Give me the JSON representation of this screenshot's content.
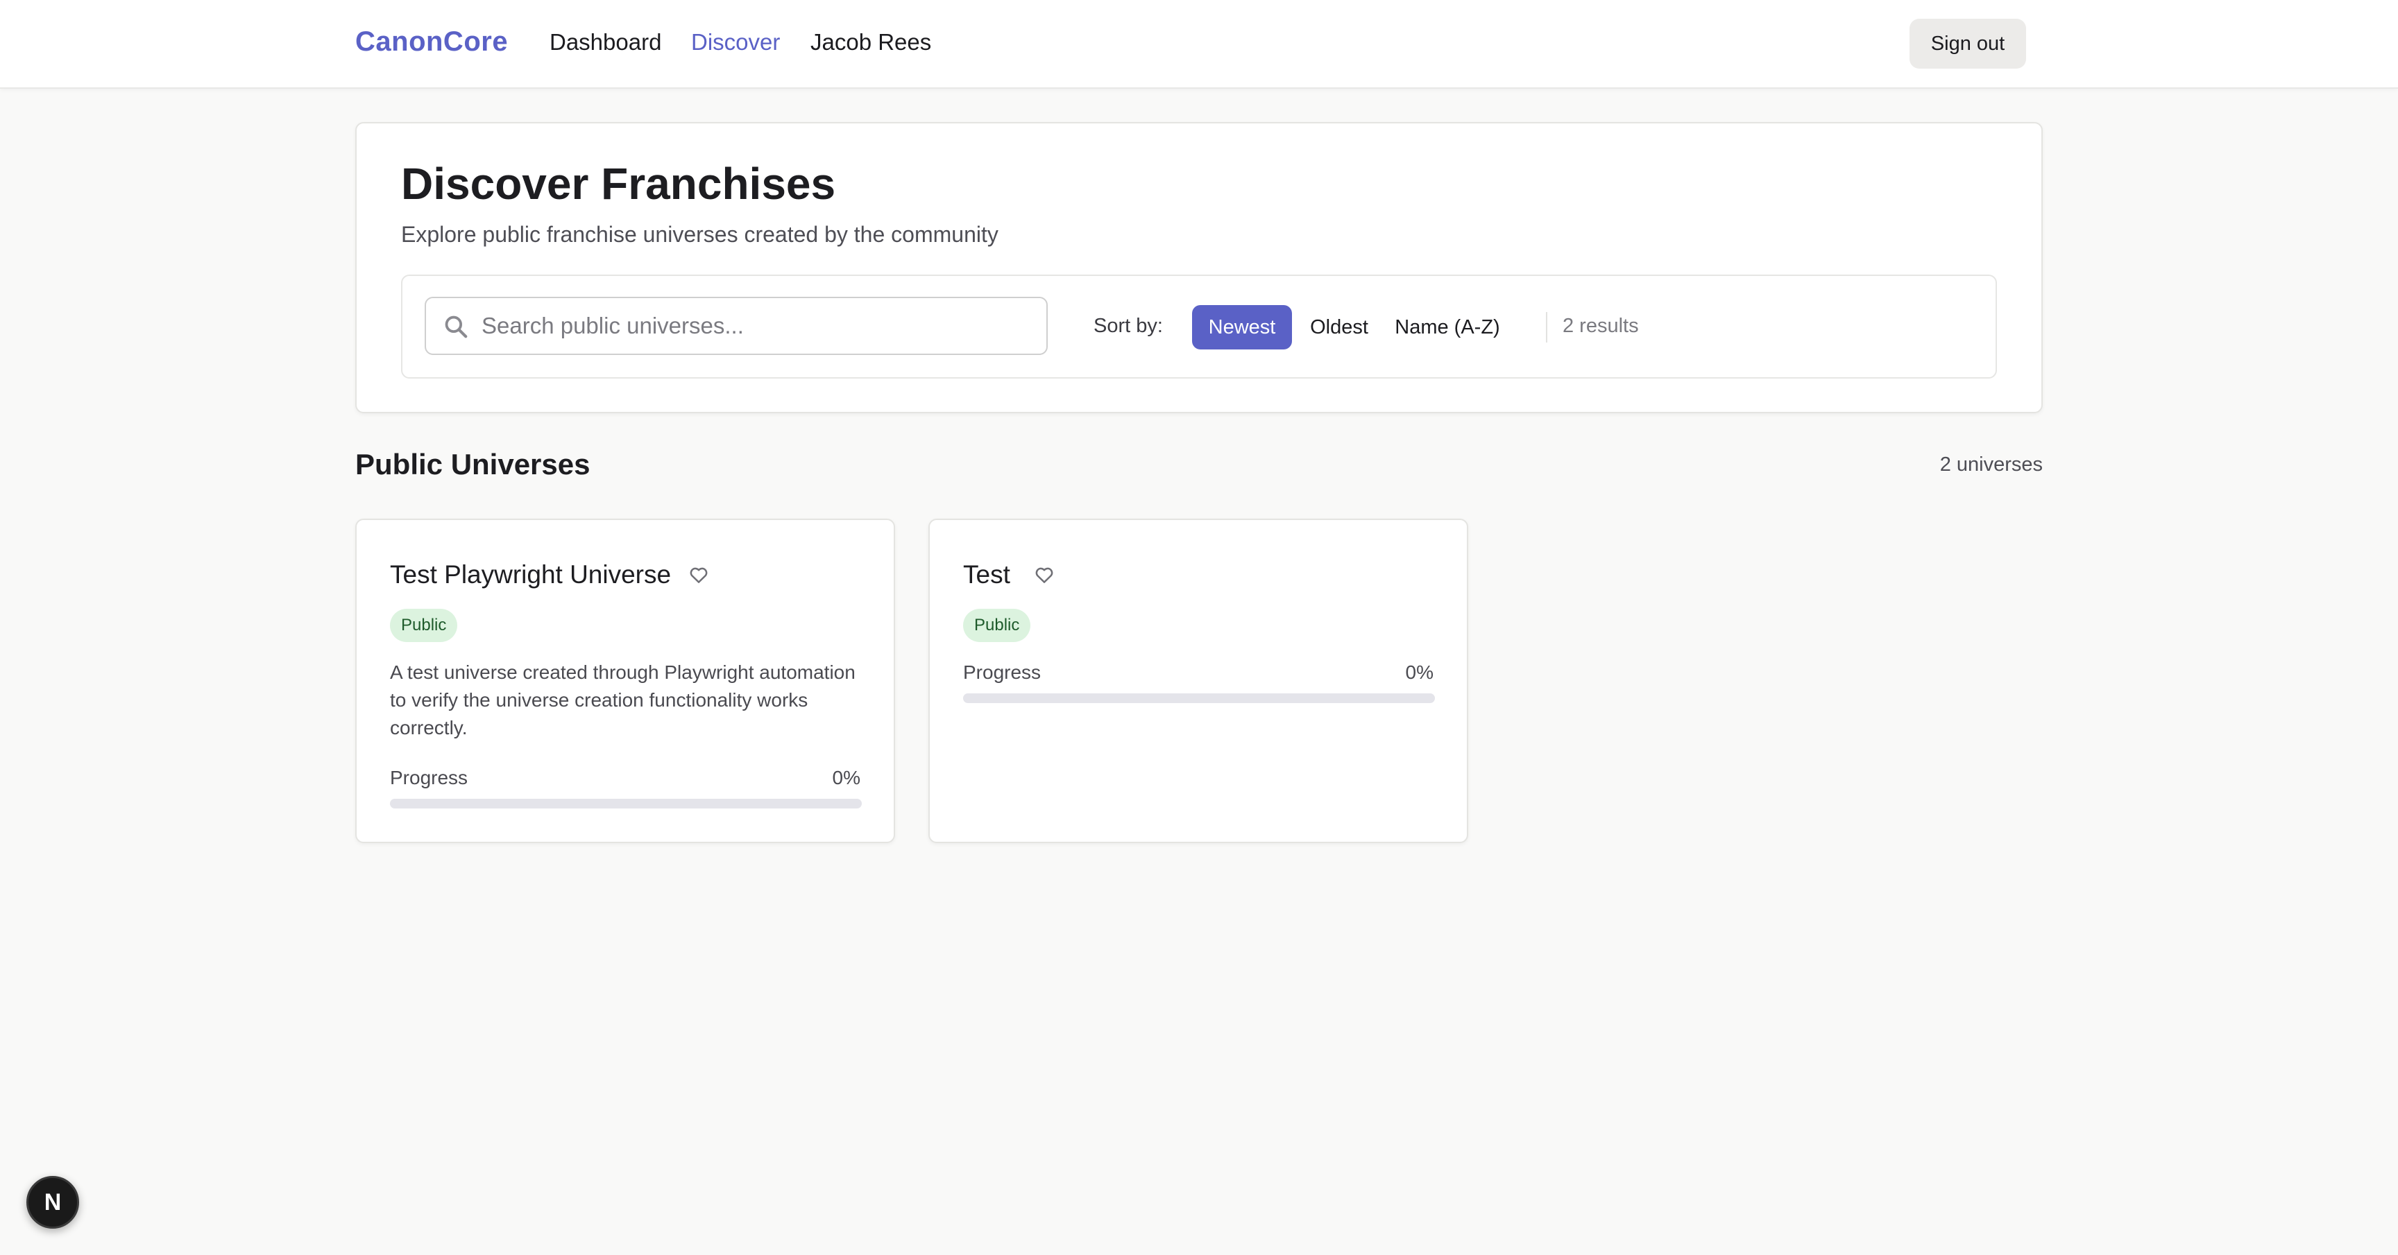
{
  "header": {
    "brand": "CanonCore",
    "nav": [
      {
        "label": "Dashboard",
        "active": false
      },
      {
        "label": "Discover",
        "active": true
      },
      {
        "label": "Jacob Rees",
        "active": false
      }
    ],
    "sign_out_label": "Sign out"
  },
  "hero": {
    "title": "Discover Franchises",
    "subtitle": "Explore public franchise universes created by the community",
    "search": {
      "placeholder": "Search public universes...",
      "value": ""
    },
    "sort_label": "Sort by:",
    "sort_options": [
      {
        "label": "Newest",
        "selected": true
      },
      {
        "label": "Oldest",
        "selected": false
      },
      {
        "label": "Name (A-Z)",
        "selected": false
      }
    ],
    "results_count": "2 results"
  },
  "section": {
    "title": "Public Universes",
    "count": "2 universes"
  },
  "universes": [
    {
      "title": "Test Playwright Universe",
      "badge": "Public",
      "description": "A test universe created through Playwright automation to verify the universe creation functionality works correctly.",
      "progress_label": "Progress",
      "progress_value": "0%",
      "progress": 0
    },
    {
      "title": "Test",
      "badge": "Public",
      "description": "",
      "progress_label": "Progress",
      "progress_value": "0%",
      "progress": 0
    }
  ],
  "fab": {
    "letter": "N"
  },
  "colors": {
    "accent": "#5a61c6",
    "badge_bg": "#dcf3df",
    "badge_text": "#1e5b2b",
    "page_bg": "#f9f9f8"
  },
  "icons": {
    "search": "search-icon",
    "favorite": "heart-icon",
    "fab": "next-logo-icon"
  }
}
